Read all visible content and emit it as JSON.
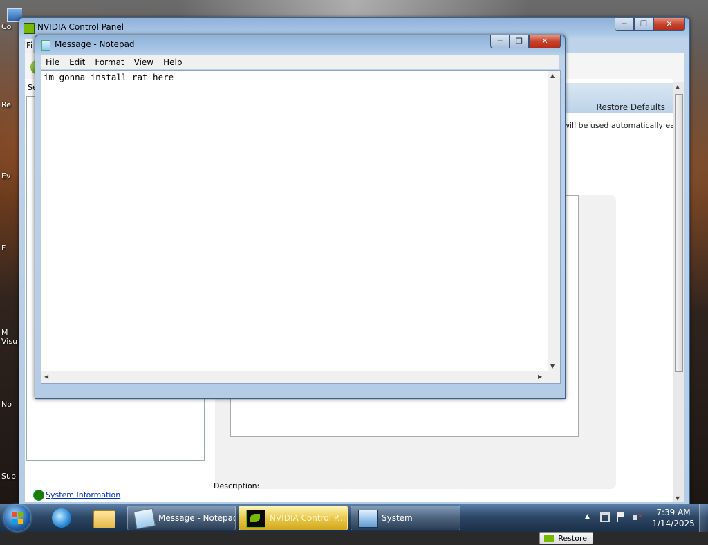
{
  "desktop": {
    "icons": [
      {
        "label": "Co"
      },
      {
        "label": "Re"
      },
      {
        "label": "Ev"
      },
      {
        "label": "F"
      },
      {
        "label": "M"
      },
      {
        "label": "Visu"
      },
      {
        "label": "No"
      },
      {
        "label": "Sup"
      }
    ]
  },
  "nvidia_window": {
    "title": "NVIDIA Control Panel",
    "menu_fragment": "Fi",
    "select_label_fragment": "Se",
    "restore_defaults": "Restore Defaults",
    "description_fragment": "will be used automatically each",
    "restore_button": "Restore",
    "description_label": "Description:",
    "system_information": "System Information"
  },
  "notepad_window": {
    "title": "Message - Notepad",
    "menu": [
      "File",
      "Edit",
      "Format",
      "View",
      "Help"
    ],
    "text": "im gonna install rat here\n"
  },
  "taskbar": {
    "tasks": [
      {
        "label": "Message - Notepad"
      },
      {
        "label": "NVIDIA Control P..."
      },
      {
        "label": "System"
      }
    ],
    "clock_time": "7:39 AM",
    "clock_date": "1/14/2025"
  }
}
